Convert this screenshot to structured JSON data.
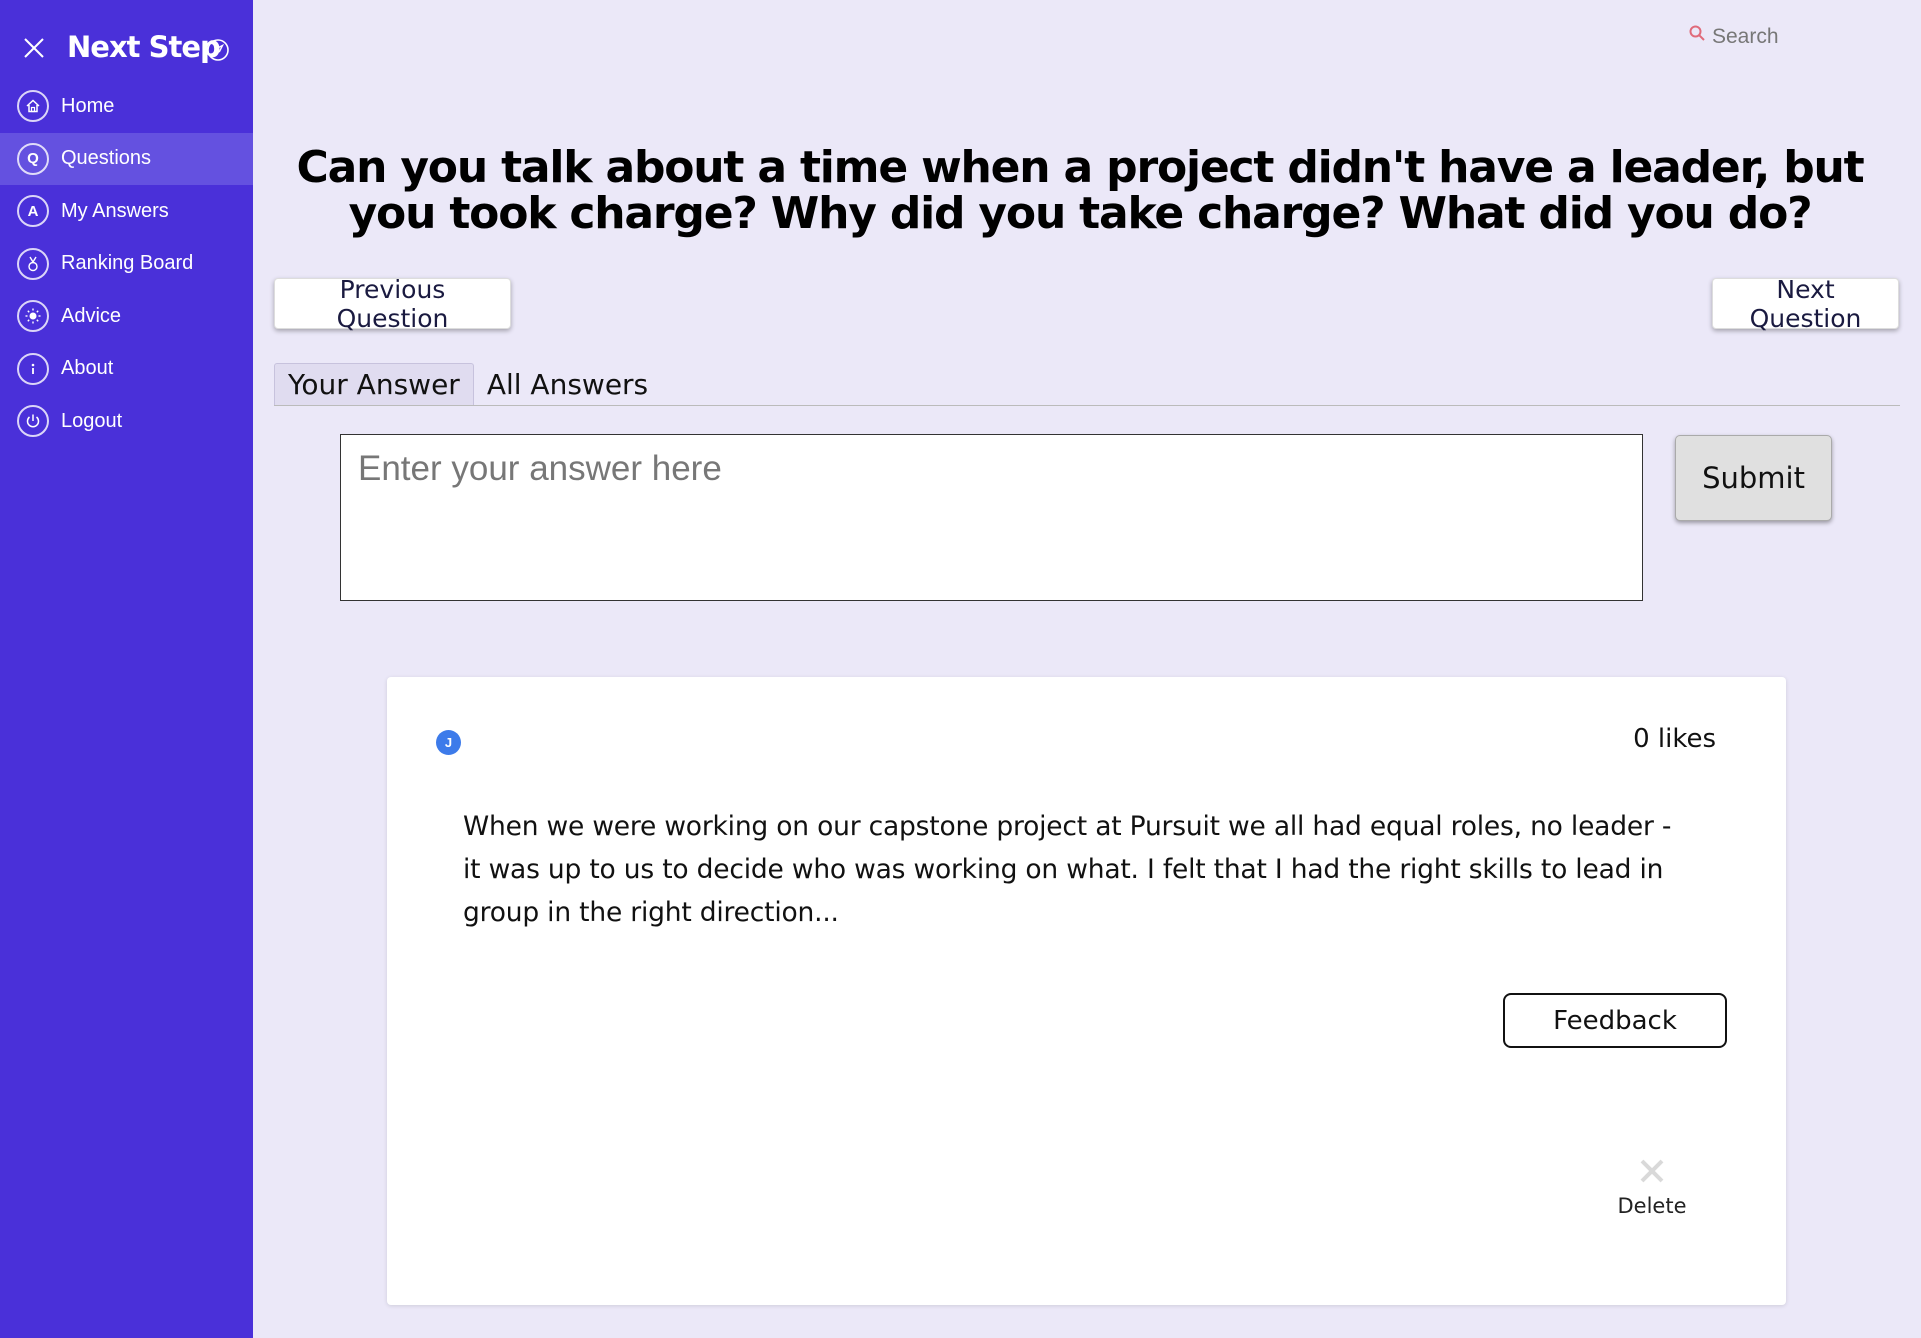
{
  "app": {
    "title": "Next Step"
  },
  "sidebar": {
    "items": [
      {
        "label": "Home",
        "icon": "home-icon",
        "active": false
      },
      {
        "label": "Questions",
        "icon": "questions-icon",
        "active": true
      },
      {
        "label": "My Answers",
        "icon": "my-answers-icon",
        "active": false
      },
      {
        "label": "Ranking Board",
        "icon": "medal-icon",
        "active": false
      },
      {
        "label": "Advice",
        "icon": "lightbulb-icon",
        "active": false
      },
      {
        "label": "About",
        "icon": "info-icon",
        "active": false
      },
      {
        "label": "Logout",
        "icon": "power-icon",
        "active": false
      }
    ]
  },
  "search": {
    "label": "Search"
  },
  "question": {
    "text": "Can you talk about a time when a project didn't have a leader, but you took charge? Why did you take charge? What did you do?"
  },
  "navigation": {
    "previous_label": "Previous Question",
    "next_label": "Next Question"
  },
  "tabs": [
    {
      "label": "Your Answer",
      "active": true
    },
    {
      "label": "All Answers",
      "active": false
    }
  ],
  "answer_form": {
    "placeholder": "Enter your answer here",
    "value": "",
    "submit_label": "Submit"
  },
  "answer_card": {
    "avatar_initial": "J",
    "likes": "0 likes",
    "text": "When we were working on our capstone project at Pursuit we all had equal roles, no leader - it was up to us to decide who was working on what. I felt that I had the right skills to lead in group in the right direction...",
    "feedback_label": "Feedback",
    "delete_label": "Delete"
  },
  "colors": {
    "sidebar": "#4a30d9",
    "sidebar_active": "#6451e0",
    "page_background": "#ebe8f8",
    "avatar": "#3d7bea",
    "search_icon": "#e06a7a"
  }
}
